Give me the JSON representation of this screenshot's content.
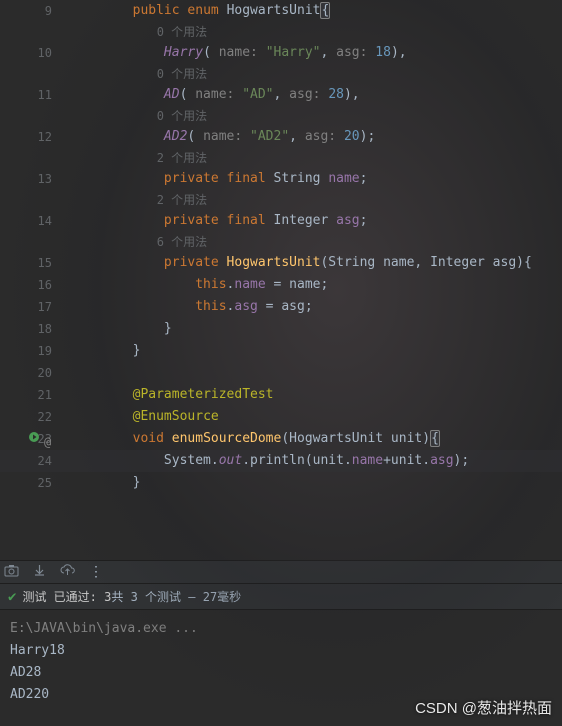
{
  "lines": [
    {
      "num": "9",
      "type": "code",
      "indent": 2,
      "tokens": [
        [
          "kw",
          "public"
        ],
        [
          "punct",
          " "
        ],
        [
          "kw",
          "enum"
        ],
        [
          "punct",
          " "
        ],
        [
          "cls",
          "HogwartsUnit"
        ],
        [
          "brace-match",
          "{"
        ]
      ]
    },
    {
      "num": "",
      "type": "hint",
      "indent": 3,
      "text": "0 个用法"
    },
    {
      "num": "10",
      "type": "code",
      "indent": 3,
      "tokens": [
        [
          "enum-const",
          "Harry"
        ],
        [
          "punct",
          "( "
        ],
        [
          "param-name",
          "name: "
        ],
        [
          "str",
          "\"Harry\""
        ],
        [
          "punct",
          ", "
        ],
        [
          "param-name",
          "asg: "
        ],
        [
          "num",
          "18"
        ],
        [
          "punct",
          "),"
        ]
      ]
    },
    {
      "num": "",
      "type": "hint",
      "indent": 3,
      "text": "0 个用法"
    },
    {
      "num": "11",
      "type": "code",
      "indent": 3,
      "tokens": [
        [
          "enum-const",
          "AD"
        ],
        [
          "punct",
          "( "
        ],
        [
          "param-name",
          "name: "
        ],
        [
          "str",
          "\"AD\""
        ],
        [
          "punct",
          ", "
        ],
        [
          "param-name",
          "asg: "
        ],
        [
          "num",
          "28"
        ],
        [
          "punct",
          "),"
        ]
      ]
    },
    {
      "num": "",
      "type": "hint",
      "indent": 3,
      "text": "0 个用法"
    },
    {
      "num": "12",
      "type": "code",
      "indent": 3,
      "tokens": [
        [
          "enum-const",
          "AD2"
        ],
        [
          "punct",
          "( "
        ],
        [
          "param-name",
          "name: "
        ],
        [
          "str",
          "\"AD2\""
        ],
        [
          "punct",
          ", "
        ],
        [
          "param-name",
          "asg: "
        ],
        [
          "num",
          "20"
        ],
        [
          "punct",
          ");"
        ]
      ]
    },
    {
      "num": "",
      "type": "hint",
      "indent": 3,
      "text": "2 个用法"
    },
    {
      "num": "13",
      "type": "code",
      "indent": 3,
      "tokens": [
        [
          "kw",
          "private"
        ],
        [
          "punct",
          " "
        ],
        [
          "kw",
          "final"
        ],
        [
          "punct",
          " "
        ],
        [
          "cls",
          "String"
        ],
        [
          "punct",
          " "
        ],
        [
          "field",
          "name"
        ],
        [
          "punct",
          ";"
        ]
      ]
    },
    {
      "num": "",
      "type": "hint",
      "indent": 3,
      "text": "2 个用法"
    },
    {
      "num": "14",
      "type": "code",
      "indent": 3,
      "tokens": [
        [
          "kw",
          "private"
        ],
        [
          "punct",
          " "
        ],
        [
          "kw",
          "final"
        ],
        [
          "punct",
          " "
        ],
        [
          "cls",
          "Integer"
        ],
        [
          "punct",
          " "
        ],
        [
          "field",
          "asg"
        ],
        [
          "punct",
          ";"
        ]
      ]
    },
    {
      "num": "",
      "type": "hint",
      "indent": 3,
      "text": "6 个用法"
    },
    {
      "num": "15",
      "type": "code",
      "indent": 3,
      "tokens": [
        [
          "kw",
          "private"
        ],
        [
          "punct",
          " "
        ],
        [
          "method",
          "HogwartsUnit"
        ],
        [
          "punct",
          "("
        ],
        [
          "cls",
          "String"
        ],
        [
          "punct",
          " name, "
        ],
        [
          "cls",
          "Integer"
        ],
        [
          "punct",
          " asg)"
        ],
        [
          "punct",
          "{"
        ]
      ]
    },
    {
      "num": "16",
      "type": "code",
      "indent": 4,
      "tokens": [
        [
          "kw",
          "this"
        ],
        [
          "punct",
          "."
        ],
        [
          "field",
          "name"
        ],
        [
          "punct",
          " = name;"
        ]
      ]
    },
    {
      "num": "17",
      "type": "code",
      "indent": 4,
      "tokens": [
        [
          "kw",
          "this"
        ],
        [
          "punct",
          "."
        ],
        [
          "field",
          "asg"
        ],
        [
          "punct",
          " = asg;"
        ]
      ]
    },
    {
      "num": "18",
      "type": "code",
      "indent": 3,
      "tokens": [
        [
          "punct",
          "}"
        ]
      ]
    },
    {
      "num": "19",
      "type": "code",
      "indent": 2,
      "tokens": [
        [
          "punct",
          "}"
        ]
      ]
    },
    {
      "num": "20",
      "type": "code",
      "indent": 0,
      "tokens": []
    },
    {
      "num": "21",
      "type": "code",
      "indent": 2,
      "tokens": [
        [
          "annotation",
          "@ParameterizedTest"
        ]
      ]
    },
    {
      "num": "22",
      "type": "code",
      "indent": 2,
      "tokens": [
        [
          "annotation",
          "@EnumSource"
        ]
      ]
    },
    {
      "num": "23",
      "type": "code",
      "indent": 2,
      "runicon": true,
      "tokens": [
        [
          "kw",
          "void"
        ],
        [
          "punct",
          " "
        ],
        [
          "method",
          "enumSourceDome"
        ],
        [
          "punct",
          "("
        ],
        [
          "cls",
          "HogwartsUnit"
        ],
        [
          "punct",
          " unit)"
        ],
        [
          "brace-match",
          "{"
        ]
      ]
    },
    {
      "num": "24",
      "type": "code",
      "indent": 3,
      "current": true,
      "tokens": [
        [
          "cls",
          "System"
        ],
        [
          "punct",
          "."
        ],
        [
          "static-field",
          "out"
        ],
        [
          "punct",
          ".println(unit."
        ],
        [
          "field",
          "name"
        ],
        [
          "punct",
          "+unit."
        ],
        [
          "field",
          "asg"
        ],
        [
          "punct",
          ");"
        ]
      ]
    },
    {
      "num": "25",
      "type": "code",
      "indent": 2,
      "tokens": [
        [
          "punct",
          "}"
        ]
      ]
    }
  ],
  "test_status": {
    "label_prefix": "测试 已通过: ",
    "passed": "3",
    "middle": "共 3 个测试",
    "time": " – 27毫秒"
  },
  "console": {
    "cmd": "E:\\JAVA\\bin\\java.exe ...",
    "out": [
      "Harry18",
      "AD28",
      "AD220"
    ]
  },
  "watermark": "CSDN @葱油拌热面",
  "more_menu": "⋮"
}
